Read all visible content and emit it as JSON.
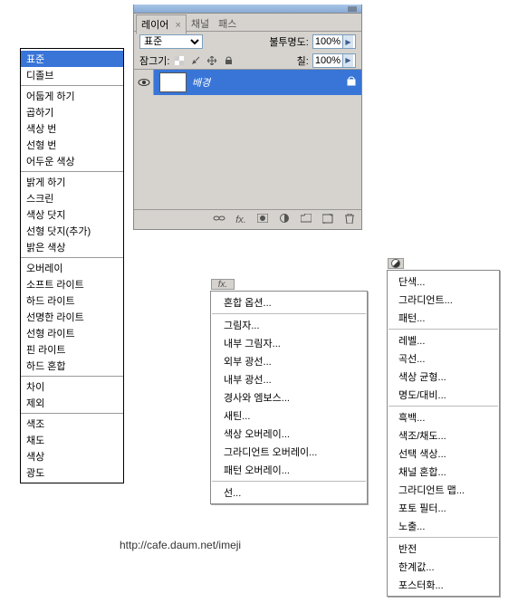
{
  "blend_modes": {
    "groups": [
      [
        "표준",
        "디졸브"
      ],
      [
        "어둡게 하기",
        "곱하기",
        "색상 번",
        "선형 번",
        "어두운 색상"
      ],
      [
        "밝게 하기",
        "스크린",
        "색상 닷지",
        "선형 닷지(추가)",
        "밝은 색상"
      ],
      [
        "오버레이",
        "소프트 라이트",
        "하드 라이트",
        "선명한 라이트",
        "선형 라이트",
        "핀 라이트",
        "하드 혼합"
      ],
      [
        "차이",
        "제외"
      ],
      [
        "색조",
        "채도",
        "색상",
        "광도"
      ]
    ],
    "selected": "표준"
  },
  "layers_panel": {
    "tabs": [
      "레이어",
      "채널",
      "패스"
    ],
    "active_tab_close": "×",
    "blend_select": "표준",
    "opacity_label": "불투명도:",
    "opacity_value": "100%",
    "lock_label": "잠그기:",
    "fill_label": "칠:",
    "fill_value": "100%",
    "layer": {
      "name": "배경"
    }
  },
  "fx_menu": {
    "badge": "fx.",
    "groups": [
      [
        "혼합 옵션..."
      ],
      [
        "그림자...",
        "내부 그림자...",
        "외부 광선...",
        "내부 광선...",
        "경사와 엠보스...",
        "새틴...",
        "색상 오버레이...",
        "그라디언트 오버레이...",
        "패턴 오버레이..."
      ],
      [
        "선..."
      ]
    ]
  },
  "adj_menu": {
    "groups": [
      [
        "단색...",
        "그라디언트...",
        "패턴..."
      ],
      [
        "레벨...",
        "곡선...",
        "색상 균형...",
        "명도/대비..."
      ],
      [
        "흑백...",
        "색조/채도...",
        "선택 색상...",
        "채널 혼합...",
        "그라디언트 맵...",
        "포토 필터...",
        "노출..."
      ],
      [
        "반전",
        "한계값...",
        "포스터화..."
      ]
    ]
  },
  "url": "http://cafe.daum.net/imeji"
}
